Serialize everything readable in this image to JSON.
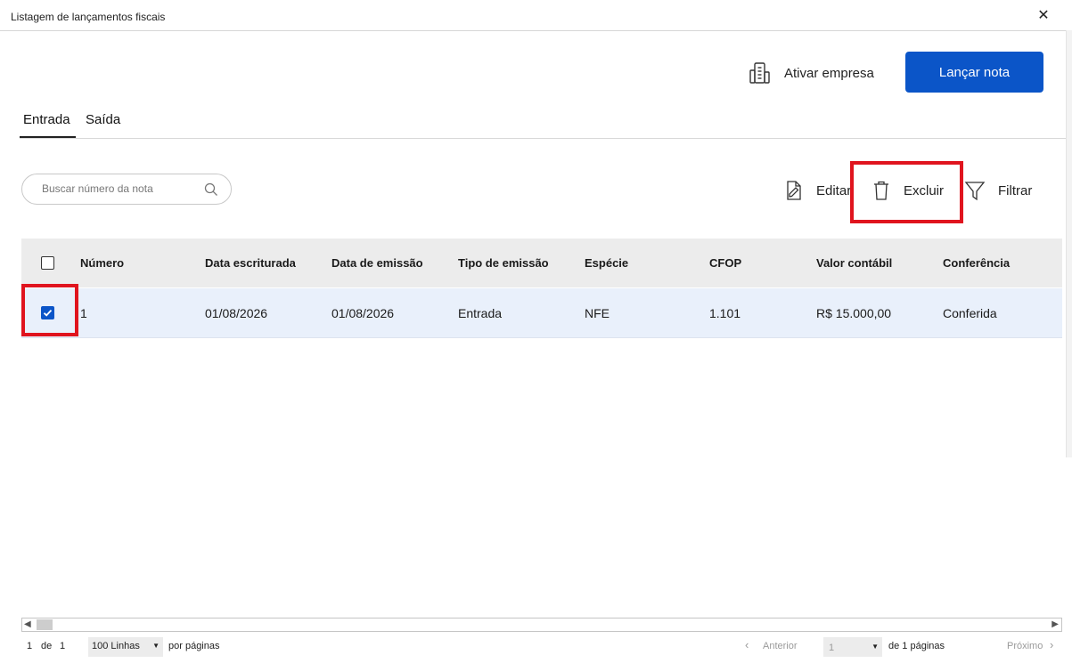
{
  "window": {
    "title": "Listagem de lançamentos fiscais",
    "close_glyph": "✕"
  },
  "header": {
    "ativar_label": "Ativar empresa",
    "lancar_label": "Lançar nota"
  },
  "tabs": [
    {
      "label": "Entrada",
      "active": true
    },
    {
      "label": "Saída",
      "active": false
    }
  ],
  "search": {
    "placeholder": "Buscar número da nota",
    "value": ""
  },
  "actions": {
    "editar": "Editar",
    "excluir": "Excluir",
    "filtrar": "Filtrar"
  },
  "table": {
    "columns": [
      "Número",
      "Data escriturada",
      "Data de emissão",
      "Tipo de emissão",
      "Espécie",
      "CFOP",
      "Valor contábil",
      "Conferência"
    ],
    "rows": [
      {
        "selected": true,
        "cells": [
          "1",
          "01/08/2026",
          "01/08/2026",
          "Entrada",
          "NFE",
          "1.101",
          "R$ 15.000,00",
          "Conferida"
        ]
      }
    ]
  },
  "pagination": {
    "current": "1",
    "de": "de",
    "total": "1",
    "rows_option": "100 Linhas",
    "por_paginas": "por páginas",
    "anterior": "Anterior",
    "page_select": "1",
    "de_paginas": "de 1 páginas",
    "proximo": "Próximo"
  },
  "colors": {
    "accent": "#0b55c8",
    "highlight": "#e0141e",
    "selected_row": "#e9f0fb",
    "header_bg": "#ececec"
  },
  "icons": [
    "close-icon",
    "building-icon",
    "search-icon",
    "edit-document-icon",
    "trash-icon",
    "filter-icon",
    "checkmark-icon",
    "chevron-left-icon",
    "chevron-right-icon",
    "dropdown-arrow-icon"
  ]
}
